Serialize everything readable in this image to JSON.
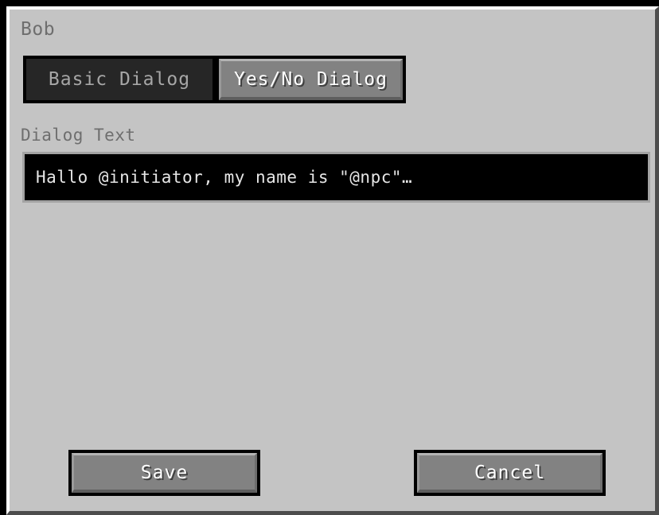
{
  "window": {
    "npc_name": "Bob",
    "frame_color": "#000000",
    "panel_color": "#c4c4c4",
    "bevel_highlight": "#ffffff",
    "bevel_shadow": "#4d4d4d"
  },
  "tabs": {
    "selected_index": 1,
    "items": [
      {
        "label": "Basic Dialog",
        "state": "inactive"
      },
      {
        "label": "Yes/No Dialog",
        "state": "active"
      }
    ],
    "active_bg": "#828282",
    "inactive_bg": "#262626"
  },
  "dialog_text_field": {
    "label": "Dialog Text",
    "value": "Hallo @initiator, my name is \"@npc\"…",
    "placeholder": "",
    "bg_color": "#000000",
    "text_color": "#e6e6e6",
    "border_color": "#a3a3a3"
  },
  "footer": {
    "save_label": "Save",
    "cancel_label": "Cancel",
    "button_bg": "#828282"
  }
}
